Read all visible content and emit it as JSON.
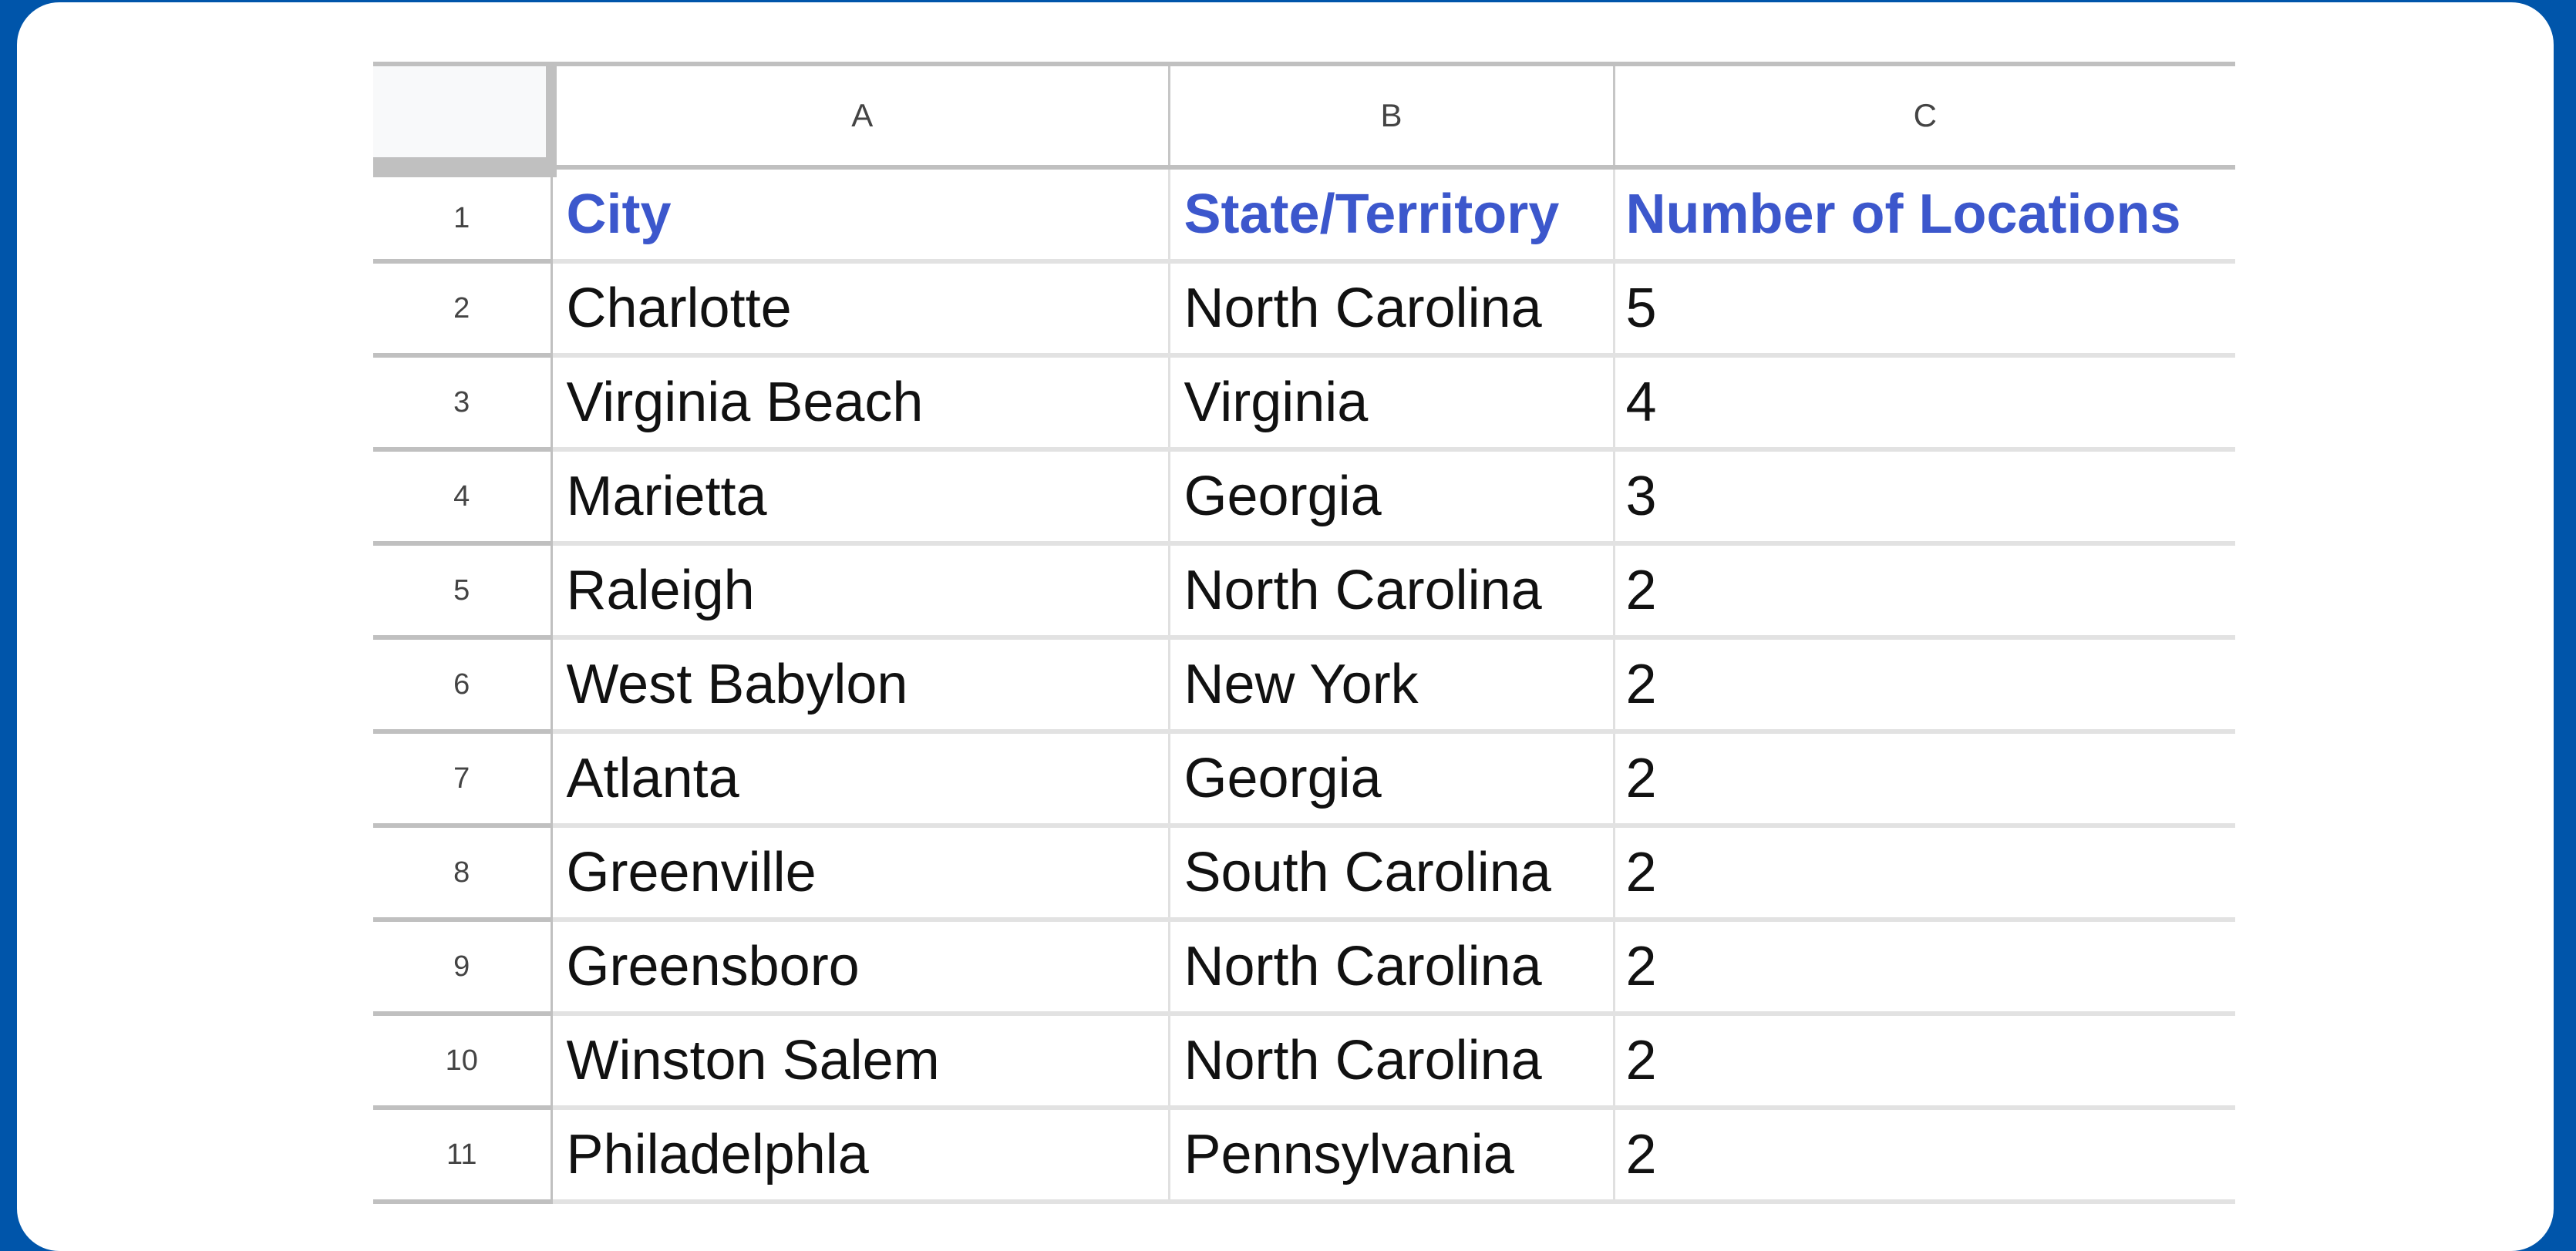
{
  "sheet": {
    "column_headers": [
      "A",
      "B",
      "C"
    ],
    "header_row": {
      "row_number": "1",
      "cells": [
        "City",
        "State/Territory",
        "Number of Locations"
      ]
    },
    "rows": [
      {
        "row_number": "2",
        "cells": [
          "Charlotte",
          "North Carolina",
          "5"
        ]
      },
      {
        "row_number": "3",
        "cells": [
          "Virginia Beach",
          "Virginia",
          "4"
        ]
      },
      {
        "row_number": "4",
        "cells": [
          "Marietta",
          "Georgia",
          "3"
        ]
      },
      {
        "row_number": "5",
        "cells": [
          "Raleigh",
          "North Carolina",
          "2"
        ]
      },
      {
        "row_number": "6",
        "cells": [
          "West Babylon",
          "New York",
          "2"
        ]
      },
      {
        "row_number": "7",
        "cells": [
          "Atlanta",
          "Georgia",
          "2"
        ]
      },
      {
        "row_number": "8",
        "cells": [
          "Greenville",
          "South Carolina",
          "2"
        ]
      },
      {
        "row_number": "9",
        "cells": [
          "Greensboro",
          "North Carolina",
          "2"
        ]
      },
      {
        "row_number": "10",
        "cells": [
          "Winston Salem",
          "North Carolina",
          "2"
        ]
      },
      {
        "row_number": "11",
        "cells": [
          "Philadelphla",
          "Pennsylvania",
          "2"
        ]
      }
    ]
  },
  "colors": {
    "frame": "#0055aa",
    "header_text": "#3c57cc",
    "gridline": "#e2e2e2",
    "header_border": "#c0c0c0"
  }
}
